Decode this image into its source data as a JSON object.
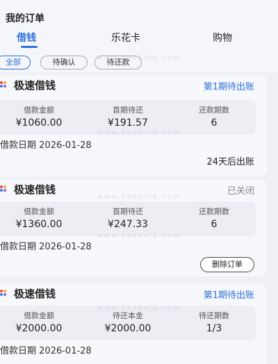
{
  "header": {
    "title": "我的订单"
  },
  "tabs": [
    {
      "label": "借钱",
      "active": true
    },
    {
      "label": "乐花卡",
      "active": false
    },
    {
      "label": "购物",
      "active": false
    }
  ],
  "filters": [
    {
      "label": "全部",
      "active": true
    },
    {
      "label": "待确认",
      "active": false
    },
    {
      "label": "待还款",
      "active": false
    }
  ],
  "orders": [
    {
      "product": "极速借钱",
      "status": "第1期待出账",
      "status_color": "#2c6fd8",
      "stats": [
        {
          "label": "借款金额",
          "value": "¥1060.00"
        },
        {
          "label": "首期待还",
          "value": "¥191.57"
        },
        {
          "label": "还款期数",
          "value": "6"
        }
      ],
      "date_label": "借款日期",
      "date": "2026-01-28",
      "note": "24天后出账"
    },
    {
      "product": "极速借钱",
      "status": "已关闭",
      "status_color": "#888888",
      "stats": [
        {
          "label": "借款金额",
          "value": "¥1360.00"
        },
        {
          "label": "首期待还",
          "value": "¥247.33"
        },
        {
          "label": "还款期数",
          "value": "6"
        }
      ],
      "date_label": "借款日期",
      "date": "2026-01-28",
      "action": "删除订单"
    },
    {
      "product": "极速借钱",
      "status": "第1期待出账",
      "status_color": "#2c6fd8",
      "stats": [
        {
          "label": "借款金额",
          "value": "¥2000.00"
        },
        {
          "label": "待还本金",
          "value": "¥2000.00"
        },
        {
          "label": "待还期数",
          "value": "1/3"
        }
      ],
      "date_label": "借款日期",
      "date": "2026-01-28"
    }
  ],
  "watermark": "www.kadaxia.com"
}
